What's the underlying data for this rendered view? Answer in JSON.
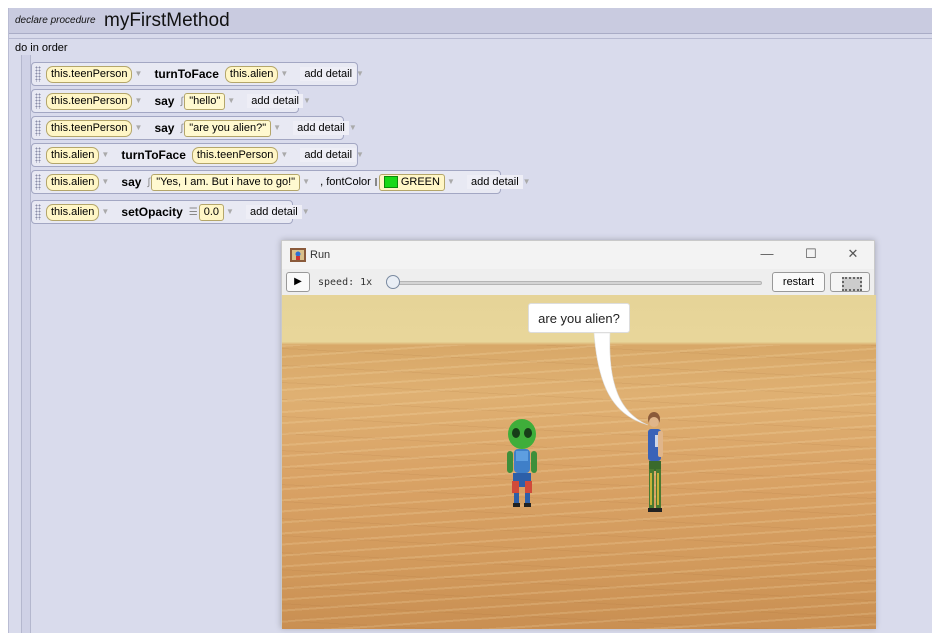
{
  "procedure": {
    "keyword": "declare procedure",
    "name": "myFirstMethod"
  },
  "block": {
    "label": "do in order"
  },
  "statements": [
    {
      "subject": "this.teenPerson",
      "method": "turnToFace",
      "args": [
        "this.alien"
      ],
      "detail": "add detail"
    },
    {
      "subject": "this.teenPerson",
      "method": "say",
      "args": [
        "\"hello\""
      ],
      "detail": "add detail"
    },
    {
      "subject": "this.teenPerson",
      "method": "say",
      "args": [
        "\"are you alien?\""
      ],
      "detail": "add detail"
    },
    {
      "subject": "this.alien",
      "method": "turnToFace",
      "args": [
        "this.teenPerson"
      ],
      "detail": "add detail"
    },
    {
      "subject": "this.alien",
      "method": "say",
      "args": [
        "\"Yes, I am. But i have to go!\""
      ],
      "extra_label": ", fontColor",
      "color_value": "GREEN",
      "detail": "add detail"
    },
    {
      "subject": "this.alien",
      "method": "setOpacity",
      "args": [
        "0.0"
      ],
      "detail": "add detail"
    }
  ],
  "run_window": {
    "title": "Run",
    "speed_label": "speed: 1x",
    "restart_label": "restart",
    "speech": "are you alien?",
    "icons": {
      "play": "play-icon",
      "fullscreen": "fullscreen-icon",
      "minimize": "minimize-icon",
      "maximize": "maximize-icon",
      "close": "close-icon"
    }
  },
  "colors": {
    "editor_bg": "#d8daeb",
    "tile_bg": "#fff6c6",
    "green_swatch": "#18d818",
    "sky": "#e6d498",
    "sand": "#d9a265"
  }
}
